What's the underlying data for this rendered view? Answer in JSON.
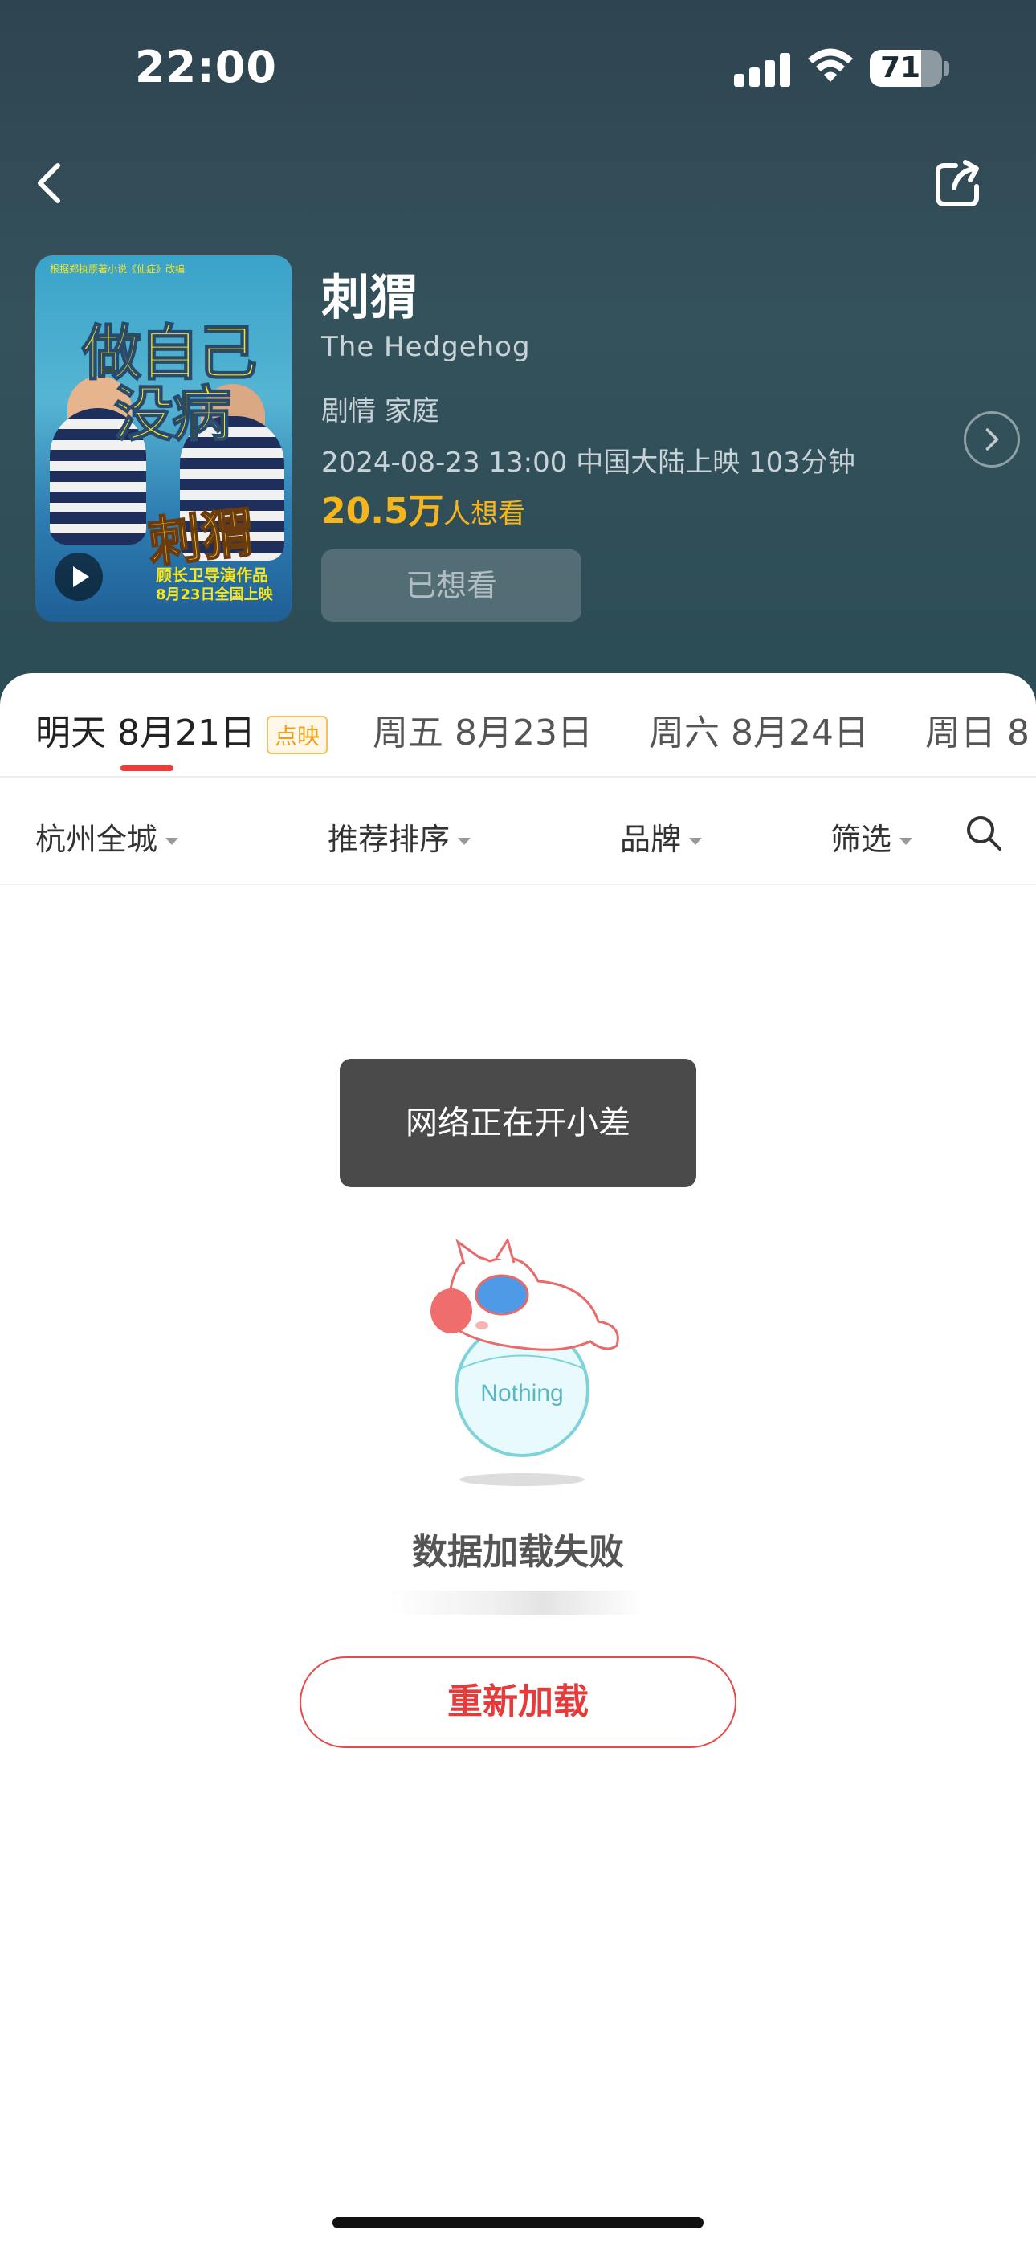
{
  "status_bar": {
    "time": "22:00",
    "battery": "71",
    "battery_level": 0.71
  },
  "movie": {
    "title": "刺猬",
    "english_title": "The Hedgehog",
    "genres": "剧情 家庭",
    "release_info": "2024-08-23 13:00 中国大陆上映 103分钟",
    "want_count": "20.5万",
    "want_label": "人想看",
    "want_button": "已想看",
    "poster": {
      "line1": "做自己",
      "line2": "没病",
      "logo": "刺猬",
      "credit": "顾长卫导演作品",
      "date": "8月23日全国上映",
      "topline": "根据郑执原著小说《仙症》改编"
    }
  },
  "date_tabs": [
    {
      "label": "明天 8月21日",
      "tag": "点映"
    },
    {
      "label": "周五 8月23日"
    },
    {
      "label": "周六 8月24日"
    },
    {
      "label": "周日 8"
    }
  ],
  "filters": [
    "杭州全城",
    "推荐排序",
    "品牌",
    "筛选"
  ],
  "toast": "网络正在开小差",
  "empty": {
    "illustration_text": "Nothing",
    "message": "数据加载失败",
    "reload_button": "重新加载"
  },
  "colors": {
    "accent": "#e63b3b",
    "want": "#f5b51c",
    "header_bg": "#2f4451"
  }
}
